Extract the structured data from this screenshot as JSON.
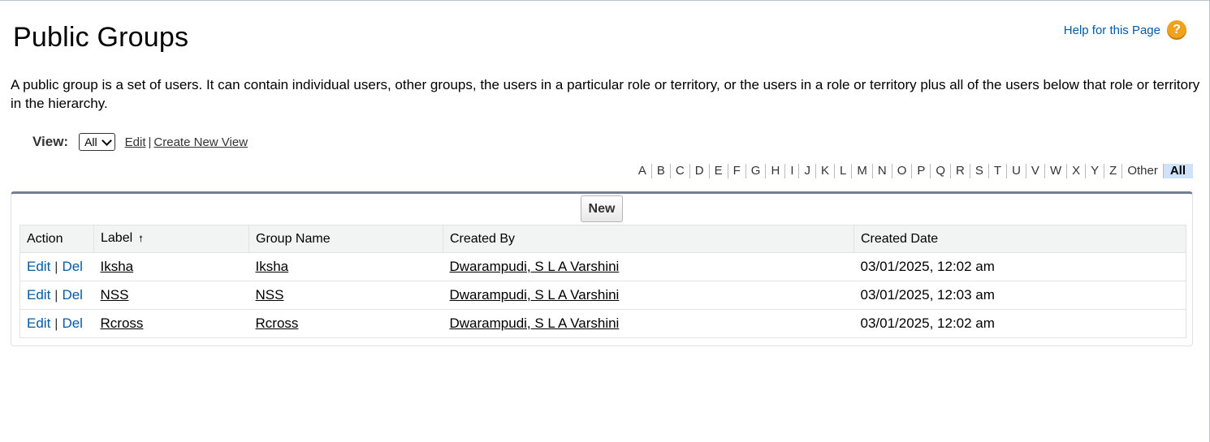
{
  "page": {
    "title": "Public Groups",
    "help_label": "Help for this Page",
    "description": "A public group is a set of users. It can contain individual users, other groups, the users in a particular role or territory, or the users in a role or territory plus all of the users below that role or territory in the hierarchy."
  },
  "view": {
    "label": "View:",
    "selected": "All",
    "edit_label": "Edit",
    "create_label": "Create New View"
  },
  "alphabet": [
    "A",
    "B",
    "C",
    "D",
    "E",
    "F",
    "G",
    "H",
    "I",
    "J",
    "K",
    "L",
    "M",
    "N",
    "O",
    "P",
    "Q",
    "R",
    "S",
    "T",
    "U",
    "V",
    "W",
    "X",
    "Y",
    "Z",
    "Other",
    "All"
  ],
  "alphabet_active": "All",
  "list": {
    "new_label": "New",
    "columns": [
      "Action",
      "Label",
      "Group Name",
      "Created By",
      "Created Date"
    ],
    "edit_label": "Edit",
    "del_label": "Del",
    "rows": [
      {
        "label": "Iksha",
        "group_name": "Iksha",
        "created_by": "Dwarampudi, S L A Varshini",
        "created_date": "03/01/2025, 12:02 am"
      },
      {
        "label": "NSS",
        "group_name": "NSS",
        "created_by": "Dwarampudi, S L A Varshini",
        "created_date": "03/01/2025, 12:03 am"
      },
      {
        "label": "Rcross",
        "group_name": "Rcross",
        "created_by": "Dwarampudi, S L A Varshini",
        "created_date": "03/01/2025, 12:02 am"
      }
    ]
  },
  "colors": {
    "link_blue": "#015ba7",
    "help_icon": "#f0a21e",
    "active_letter_bg": "#cfe2f7",
    "list_top_border": "#747e96"
  },
  "icons": {
    "help": "question-icon",
    "sort": "arrow-up-icon",
    "dropdown": "chevron-down-icon"
  }
}
